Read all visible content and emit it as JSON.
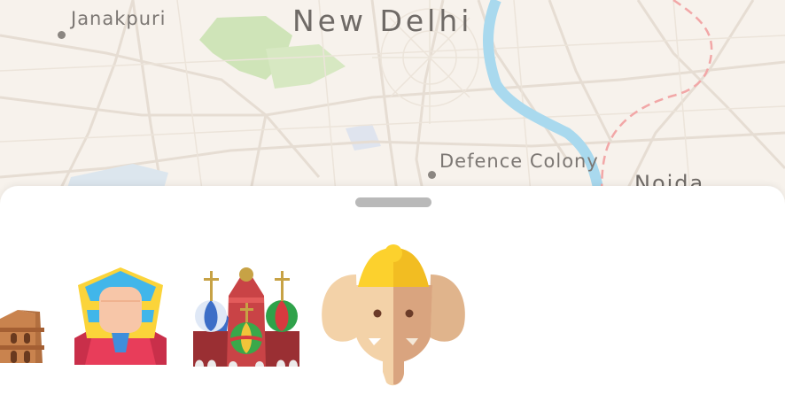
{
  "map": {
    "city_label": "New Delhi",
    "places": [
      {
        "name": "Janakpuri"
      },
      {
        "name": "Defence Colony"
      },
      {
        "name": "Noida"
      }
    ],
    "colors": {
      "background": "#f7f2ec",
      "park": "#cfe4b8",
      "river": "#a9d9ee",
      "road": "#e6ddd3",
      "rail": "#f2a7a7"
    }
  },
  "sheet": {
    "landmarks": [
      {
        "name": "colosseum-icon",
        "label": "Colosseum"
      },
      {
        "name": "sphinx-icon",
        "label": "Sphinx"
      },
      {
        "name": "st-basils-cathedral-icon",
        "label": "St. Basil's Cathedral"
      },
      {
        "name": "ganesha-icon",
        "label": "Ganesha"
      }
    ]
  }
}
